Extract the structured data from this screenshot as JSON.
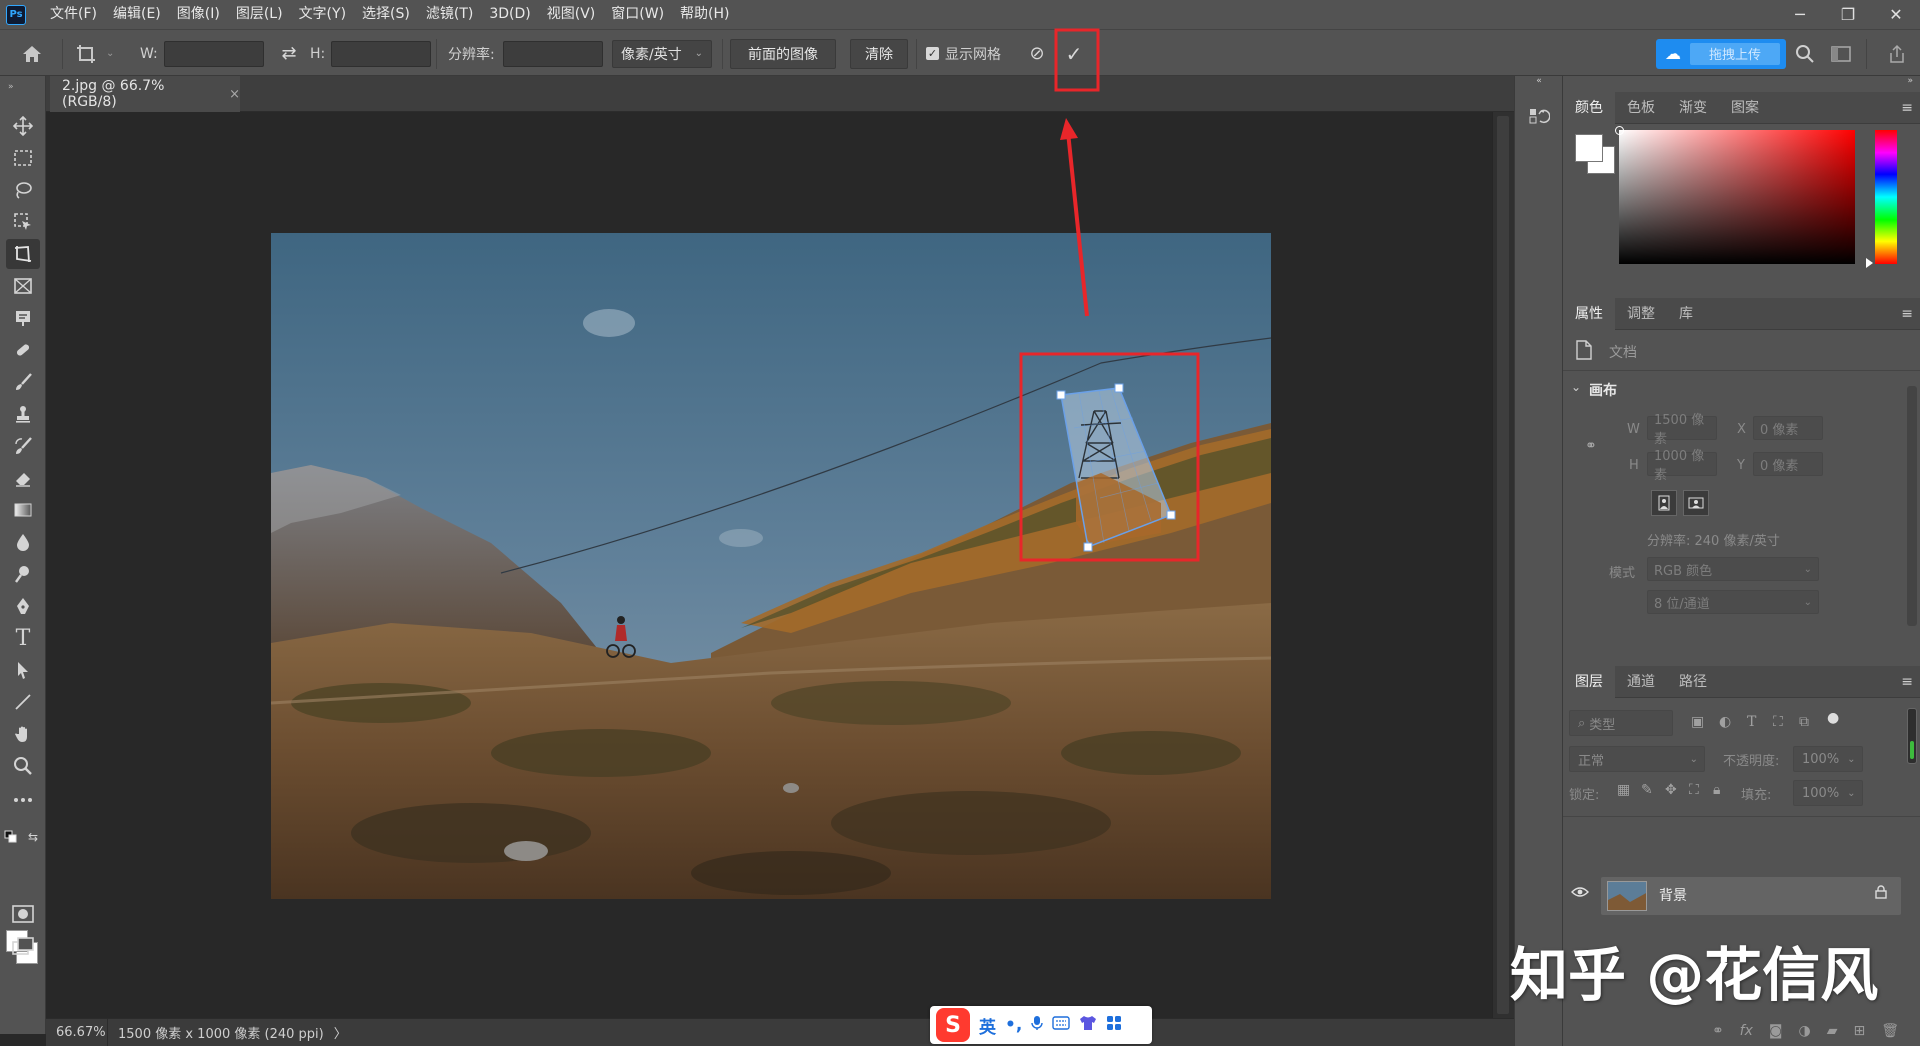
{
  "app": {
    "logo": "Ps"
  },
  "menu": [
    "文件(F)",
    "编辑(E)",
    "图像(I)",
    "图层(L)",
    "文字(Y)",
    "选择(S)",
    "滤镜(T)",
    "3D(D)",
    "视图(V)",
    "窗口(W)",
    "帮助(H)"
  ],
  "window_controls": {
    "minimize": "─",
    "restore": "❐",
    "close": "✕"
  },
  "options": {
    "w_label": "W:",
    "h_label": "H:",
    "w_value": "",
    "h_value": "",
    "swap_icon": "⇄",
    "resolution_label": "分辨率:",
    "resolution_value": "",
    "unit": "像素/英寸",
    "front_image_button": "前面的图像",
    "clear_button": "清除",
    "show_grid_label": "显示网格",
    "show_grid_checked": true,
    "cancel_icon": "⊘",
    "commit_icon": "✓",
    "upload_label": "拖拽上传"
  },
  "document": {
    "tab_title": "2.jpg @ 66.7%(RGB/8)",
    "tab_close": "×"
  },
  "status": {
    "zoom": "66.67%",
    "info": "1500 像素 x 1000 像素 (240 ppi)",
    "arrow": "〉"
  },
  "ime": {
    "logo": "S",
    "mode": "英",
    "punct": "•,",
    "icons": [
      "mic-icon",
      "keyboard-icon",
      "skin-icon",
      "apps-icon"
    ]
  },
  "color_panel": {
    "tabs": [
      "颜色",
      "色板",
      "渐变",
      "图案"
    ],
    "active_tab": 0
  },
  "properties_panel": {
    "tabs": [
      "属性",
      "调整",
      "库"
    ],
    "active_tab": 0,
    "doc_label": "文档",
    "section_title": "画布",
    "w_label": "W",
    "w_value": "1500 像素",
    "h_label": "H",
    "h_value": "1000 像素",
    "x_label": "X",
    "x_value": "0 像素",
    "y_label": "Y",
    "y_value": "0 像素",
    "resolution": "分辨率: 240 像素/英寸",
    "mode_label": "模式",
    "mode_value": "RGB 颜色",
    "depth_value": "8 位/通道"
  },
  "layers_panel": {
    "tabs": [
      "图层",
      "通道",
      "路径"
    ],
    "active_tab": 0,
    "filter_label": "类型",
    "blend_mode": "正常",
    "opacity_label": "不透明度:",
    "opacity_value": "100%",
    "lock_label": "锁定:",
    "fill_label": "填充:",
    "fill_value": "100%",
    "layer_name": "背景",
    "footer_icons": [
      "link-icon",
      "fx-icon",
      "mask-icon",
      "adjustment-icon",
      "folder-icon",
      "new-layer-icon",
      "trash-icon"
    ]
  },
  "watermark": "知乎 @花信风",
  "colors": {
    "annotation_red": "#e8262a",
    "selection_blue": "#6aa0e8",
    "upload_blue": "#1e8cf0"
  }
}
